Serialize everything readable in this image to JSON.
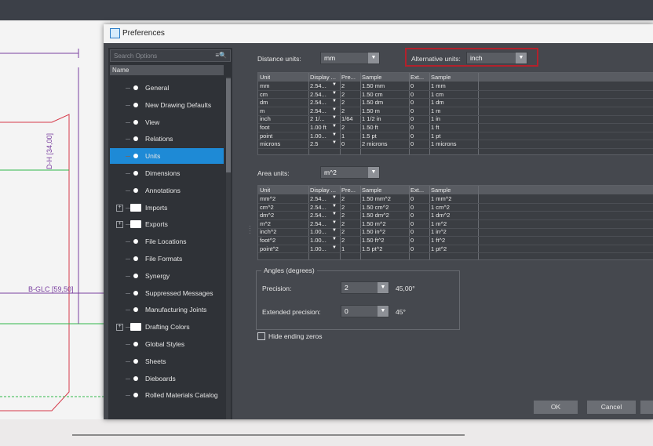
{
  "window": {
    "title": "Preferences"
  },
  "drawing": {
    "dimension_label_1": "D-H [34,00]",
    "dimension_label_2": "B-GLC [59,50]"
  },
  "left_panel": {
    "search_placeholder": "Search Options",
    "tree_header": "Name",
    "items": [
      {
        "label": "General",
        "type": "leaf"
      },
      {
        "label": "New Drawing Defaults",
        "type": "leaf"
      },
      {
        "label": "View",
        "type": "leaf"
      },
      {
        "label": "Relations",
        "type": "leaf"
      },
      {
        "label": "Units",
        "type": "leaf",
        "selected": true
      },
      {
        "label": "Dimensions",
        "type": "leaf"
      },
      {
        "label": "Annotations",
        "type": "leaf"
      },
      {
        "label": "Imports",
        "type": "folder"
      },
      {
        "label": "Exports",
        "type": "folder"
      },
      {
        "label": "File Locations",
        "type": "leaf"
      },
      {
        "label": "File Formats",
        "type": "leaf"
      },
      {
        "label": "Synergy",
        "type": "leaf"
      },
      {
        "label": "Suppressed Messages",
        "type": "leaf"
      },
      {
        "label": "Manufacturing Joints",
        "type": "leaf"
      },
      {
        "label": "Drafting Colors",
        "type": "folder"
      },
      {
        "label": "Global Styles",
        "type": "leaf"
      },
      {
        "label": "Sheets",
        "type": "leaf"
      },
      {
        "label": "Dieboards",
        "type": "leaf"
      },
      {
        "label": "Rolled Materials Catalog",
        "type": "leaf"
      }
    ]
  },
  "distance": {
    "label": "Distance units:",
    "value": "mm",
    "alt_label": "Alternative units:",
    "alt_value": "inch",
    "columns": [
      "Unit",
      "Display ...",
      "Pre...",
      "Sample",
      "Ext...",
      "Sample"
    ],
    "rows": [
      [
        "mm",
        "2.54...",
        "2",
        "1.50 mm",
        "0",
        "1 mm"
      ],
      [
        "cm",
        "2.54...",
        "2",
        "1.50 cm",
        "0",
        "1 cm"
      ],
      [
        "dm",
        "2.54...",
        "2",
        "1.50 dm",
        "0",
        "1 dm"
      ],
      [
        "m",
        "2.54...",
        "2",
        "1.50 m",
        "0",
        "1 m"
      ],
      [
        "inch",
        "2 1/...",
        "1/64",
        "1 1/2 in",
        "0",
        "1 in"
      ],
      [
        "foot",
        "1.00 ft",
        "2",
        "1.50 ft",
        "0",
        "1 ft"
      ],
      [
        "point",
        "1.00...",
        "1",
        "1.5 pt",
        "0",
        "1 pt"
      ],
      [
        "microns",
        "2.5",
        "0",
        "2 microns",
        "0",
        "1 microns"
      ]
    ]
  },
  "area": {
    "label": "Area units:",
    "value": "m^2",
    "columns": [
      "Unit",
      "Display ...",
      "Pre...",
      "Sample",
      "Ext...",
      "Sample"
    ],
    "rows": [
      [
        "mm^2",
        "2.54...",
        "2",
        "1.50 mm^2",
        "0",
        "1 mm^2"
      ],
      [
        "cm^2",
        "2.54...",
        "2",
        "1.50 cm^2",
        "0",
        "1 cm^2"
      ],
      [
        "dm^2",
        "2.54...",
        "2",
        "1.50 dm^2",
        "0",
        "1 dm^2"
      ],
      [
        "m^2",
        "2.54...",
        "2",
        "1.50 m^2",
        "0",
        "1 m^2"
      ],
      [
        "inch^2",
        "1.00...",
        "2",
        "1.50 in^2",
        "0",
        "1 in^2"
      ],
      [
        "foot^2",
        "1.00...",
        "2",
        "1.50 ft^2",
        "0",
        "1 ft^2"
      ],
      [
        "point^2",
        "1.00...",
        "1",
        "1.5 pt^2",
        "0",
        "1 pt^2"
      ]
    ]
  },
  "angles": {
    "group_title": "Angles (degrees)",
    "precision_label": "Precision:",
    "precision_value": "2",
    "precision_sample": "45,00°",
    "ext_label": "Extended precision:",
    "ext_value": "0",
    "ext_sample": "45°"
  },
  "hide_zeros_label": "Hide ending zeros",
  "buttons": {
    "ok": "OK",
    "cancel": "Cancel"
  },
  "colors": {
    "selection": "#1e8ad6",
    "highlight": "#b3212c"
  }
}
